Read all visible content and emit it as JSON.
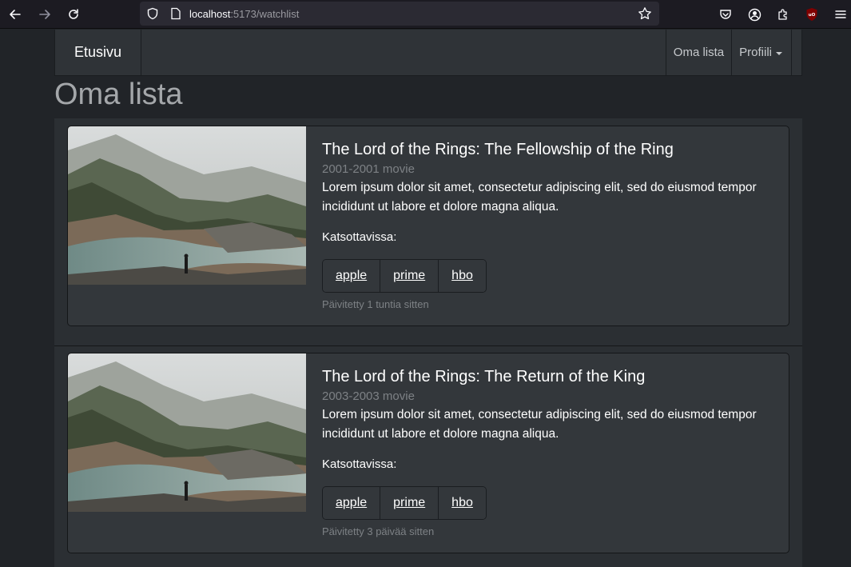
{
  "browser": {
    "url_host": "localhost",
    "url_rest": ":5173/watchlist"
  },
  "navbar": {
    "brand": "Etusivu",
    "links": [
      {
        "label": "Oma lista"
      },
      {
        "label": "Profiili"
      }
    ]
  },
  "page": {
    "title": "Oma lista",
    "availability_label": "Katsottavissa:"
  },
  "items": [
    {
      "title": "The Lord of the Rings: The Fellowship of the Ring",
      "subtitle": "2001-2001 movie",
      "description": "Lorem ipsum dolor sit amet, consectetur adipiscing elit, sed do eiusmod tempor incididunt ut labore et dolore magna aliqua.",
      "services": [
        "apple",
        "prime",
        "hbo"
      ],
      "updated": "Päivitetty 1 tuntia sitten"
    },
    {
      "title": "The Lord of the Rings: The Return of the King",
      "subtitle": "2003-2003 movie",
      "description": "Lorem ipsum dolor sit amet, consectetur adipiscing elit, sed do eiusmod tempor incididunt ut labore et dolore magna aliqua.",
      "services": [
        "apple",
        "prime",
        "hbo"
      ],
      "updated": "Päivitetty 3 päivää sitten"
    }
  ],
  "icons": {
    "back": "arrow-left-icon",
    "forward": "arrow-right-icon",
    "reload": "reload-icon",
    "shield": "shield-icon",
    "page": "page-icon",
    "star": "star-icon",
    "pocket": "pocket-icon",
    "account": "account-icon",
    "extensions": "extensions-icon",
    "ublock": "ublock-icon",
    "menu": "hamburger-menu-icon"
  }
}
